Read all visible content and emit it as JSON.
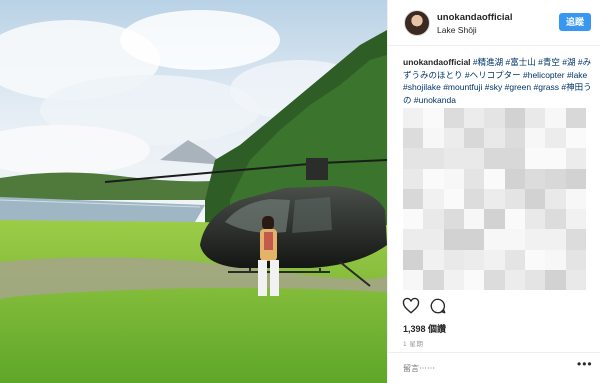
{
  "post": {
    "username": "unokandaofficial",
    "location": "Lake Shōji",
    "follow_label": "追蹤",
    "caption_user": "unokandaofficial",
    "hashtags": [
      "#精進湖",
      "#富士山",
      "#青空",
      "#湖",
      "#みずうみのほとり",
      "#ヘリコプター",
      "#helicopter",
      "#lake",
      "#shojilake",
      "#mountfuji",
      "#sky",
      "#green",
      "#grass",
      "#神田うの",
      "#unokanda"
    ],
    "likes": "1,398 個讚",
    "time_ago": "1 星期",
    "comment_placeholder": "留言⋯⋯",
    "more_label": "•••"
  },
  "icons": {
    "like": "heart-icon",
    "comment": "comment-bubble-icon",
    "more": "more-options-icon"
  },
  "colors": {
    "accent": "#3897f0",
    "hashtag": "#003569",
    "text": "#262626"
  }
}
